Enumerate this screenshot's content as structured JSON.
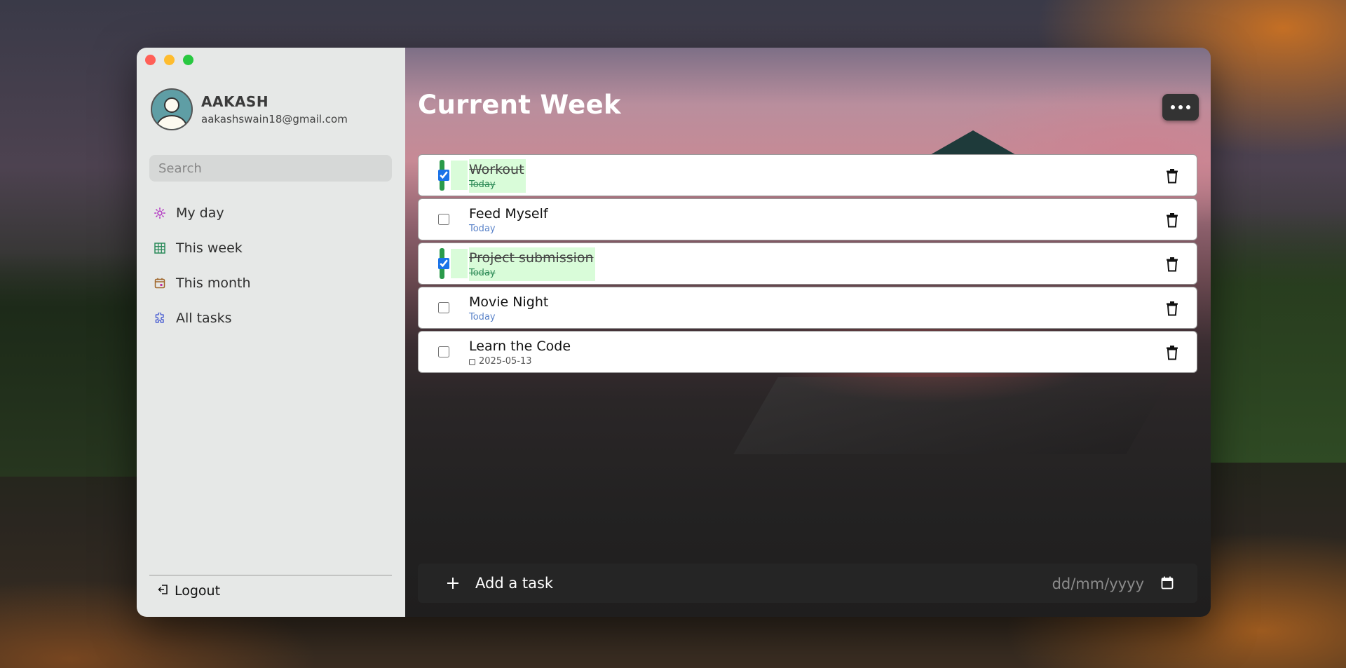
{
  "user": {
    "name": "AAKASH",
    "email": "aakashswain18@gmail.com"
  },
  "search": {
    "placeholder": "Search"
  },
  "sidebar": {
    "items": [
      {
        "label": "My day",
        "icon": "sun-icon",
        "color": "#b030c0"
      },
      {
        "label": "This week",
        "icon": "grid-icon",
        "color": "#2a8a5a"
      },
      {
        "label": "This month",
        "icon": "calendar-icon",
        "color": "#a0662a"
      },
      {
        "label": "All tasks",
        "icon": "puzzle-icon",
        "color": "#3a50d0"
      }
    ],
    "logout_label": "Logout"
  },
  "main": {
    "title": "Current Week",
    "tasks": [
      {
        "title": "Workout",
        "date": "Today",
        "done": true
      },
      {
        "title": "Feed Myself",
        "date": "Today",
        "done": false
      },
      {
        "title": "Project submission",
        "date": "Today",
        "done": true
      },
      {
        "title": "Movie Night",
        "date": "Today",
        "done": false
      },
      {
        "title": "Learn the Code",
        "date": "2025-05-13",
        "done": false
      }
    ],
    "add_task": {
      "placeholder": "Add a task",
      "date_placeholder": "dd/mm/yyyy"
    }
  },
  "colors": {
    "sidebar_bg": "#e6e8e7",
    "add_bar_bg": "#252525",
    "done_highlight": "#d9fcd9",
    "accent": "#1a73e8"
  }
}
